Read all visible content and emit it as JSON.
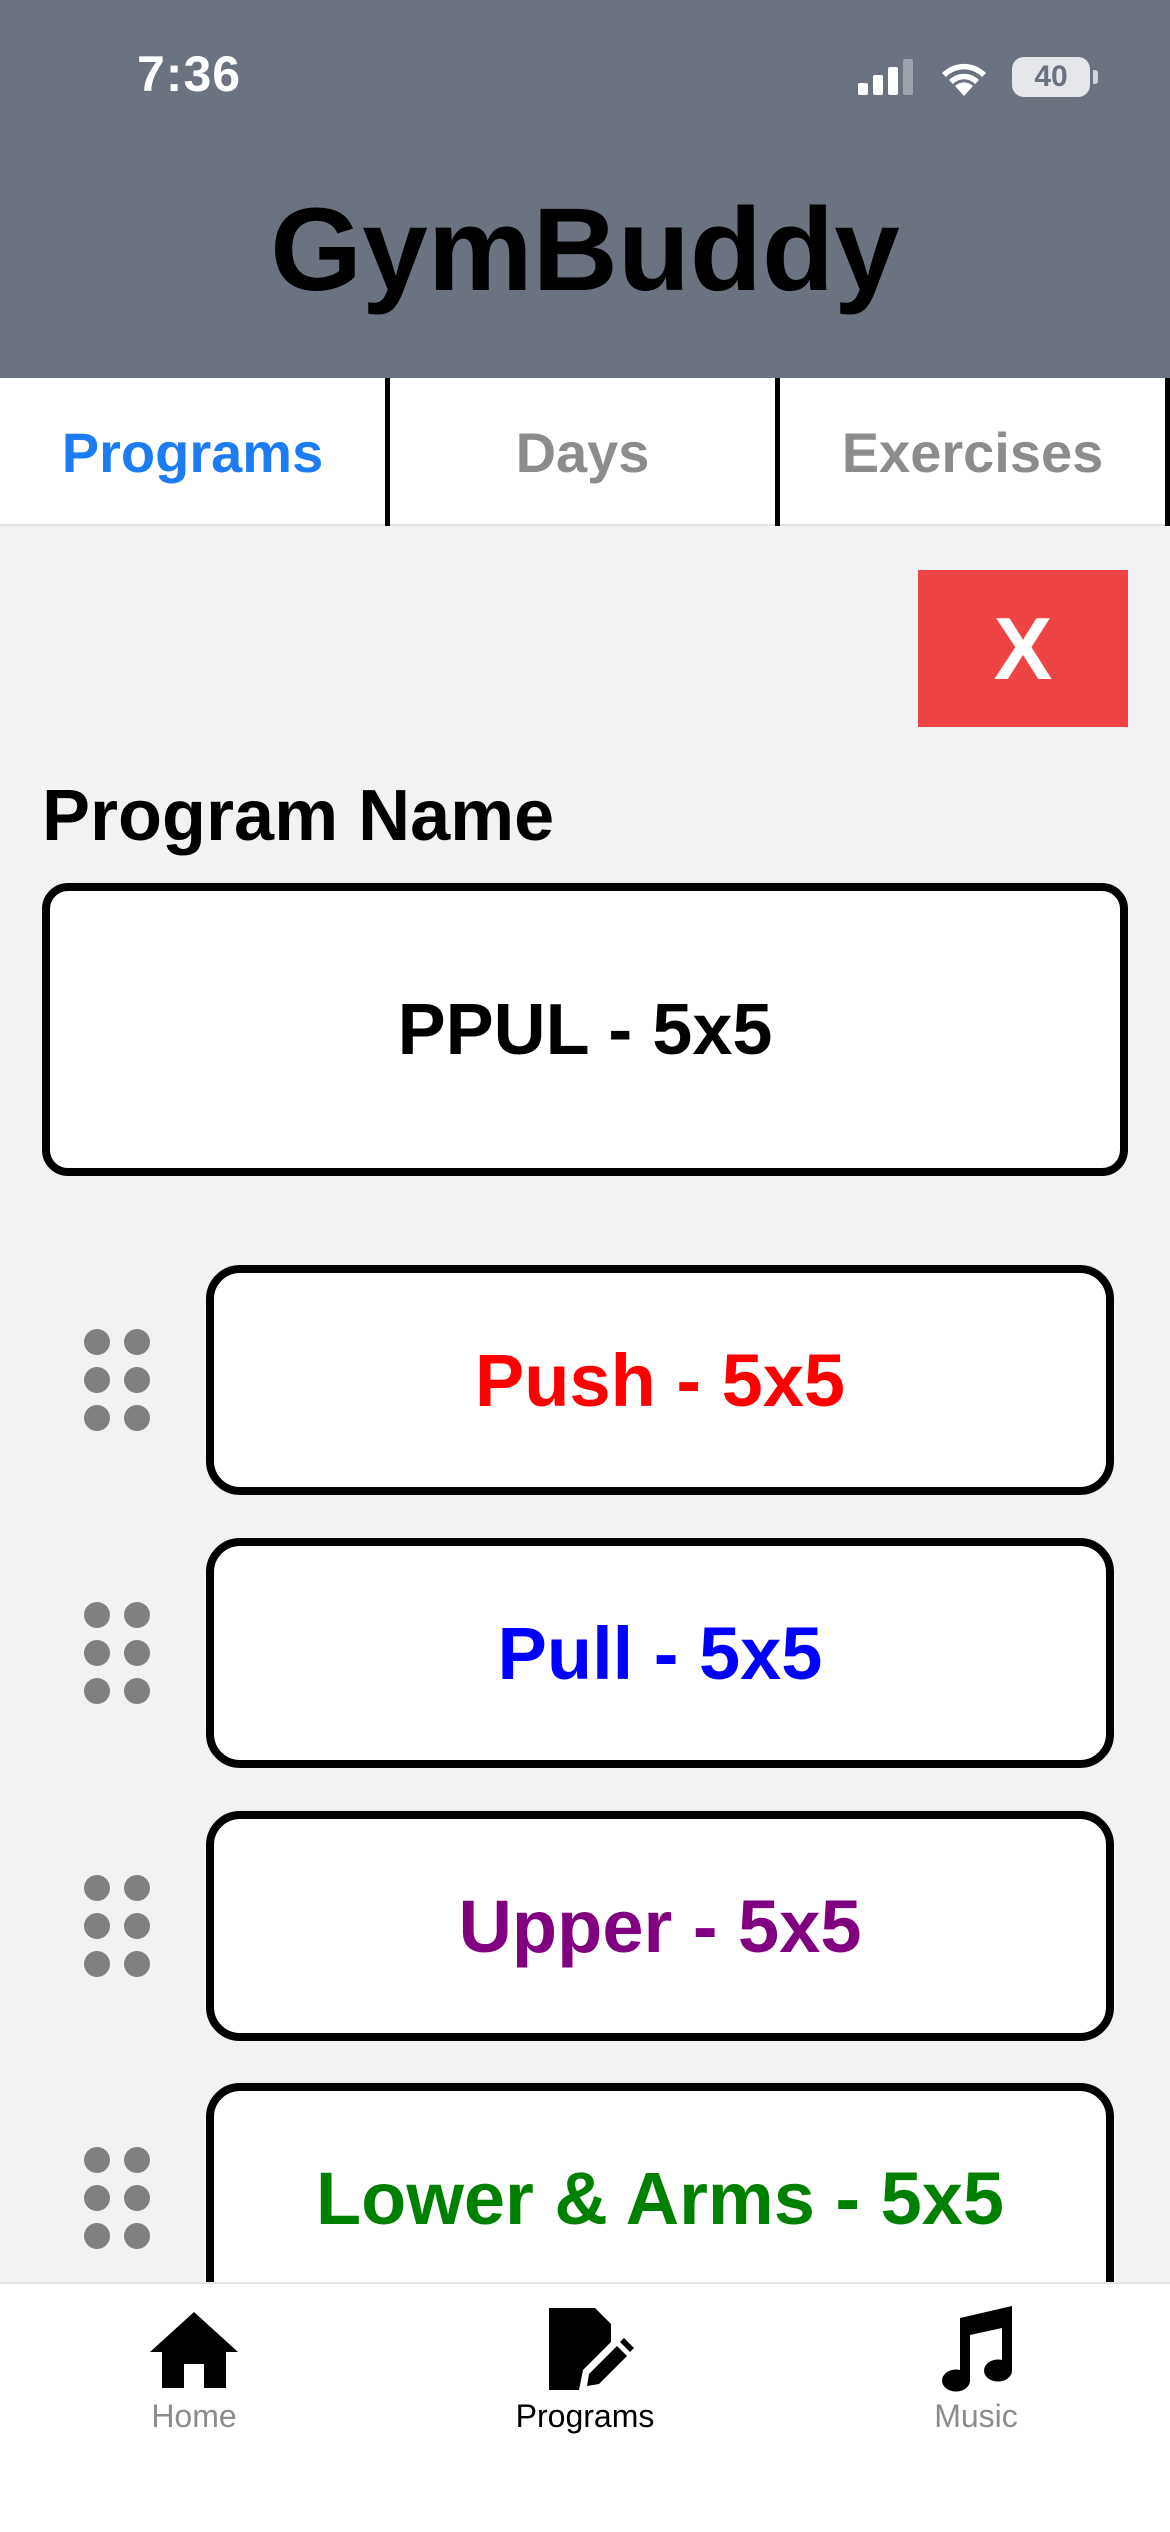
{
  "status_bar": {
    "time": "7:36",
    "battery": "40"
  },
  "header": {
    "title": "GymBuddy"
  },
  "tabs": [
    {
      "label": "Programs",
      "active": true
    },
    {
      "label": "Days",
      "active": false
    },
    {
      "label": "Exercises",
      "active": false
    }
  ],
  "close_button": {
    "label": "X",
    "color": "#ef4444"
  },
  "program": {
    "name_label": "Program Name",
    "name_value": "PPUL - 5x5"
  },
  "days": [
    {
      "label": "Push - 5x5",
      "color": "#ff0000"
    },
    {
      "label": "Pull - 5x5",
      "color": "#0000ff"
    },
    {
      "label": "Upper - 5x5",
      "color": "#800080"
    },
    {
      "label": "Lower & Arms - 5x5",
      "color": "#008000"
    }
  ],
  "bottom_nav": [
    {
      "label": "Home",
      "icon": "home-icon",
      "active": false
    },
    {
      "label": "Programs",
      "icon": "edit-document-icon",
      "active": true
    },
    {
      "label": "Music",
      "icon": "music-note-icon",
      "active": false
    }
  ],
  "colors": {
    "header_bg": "#6b7280",
    "active_tab": "#1d7cf2",
    "inactive_tab": "#8c8c8c",
    "background": "#f2f2f2"
  }
}
